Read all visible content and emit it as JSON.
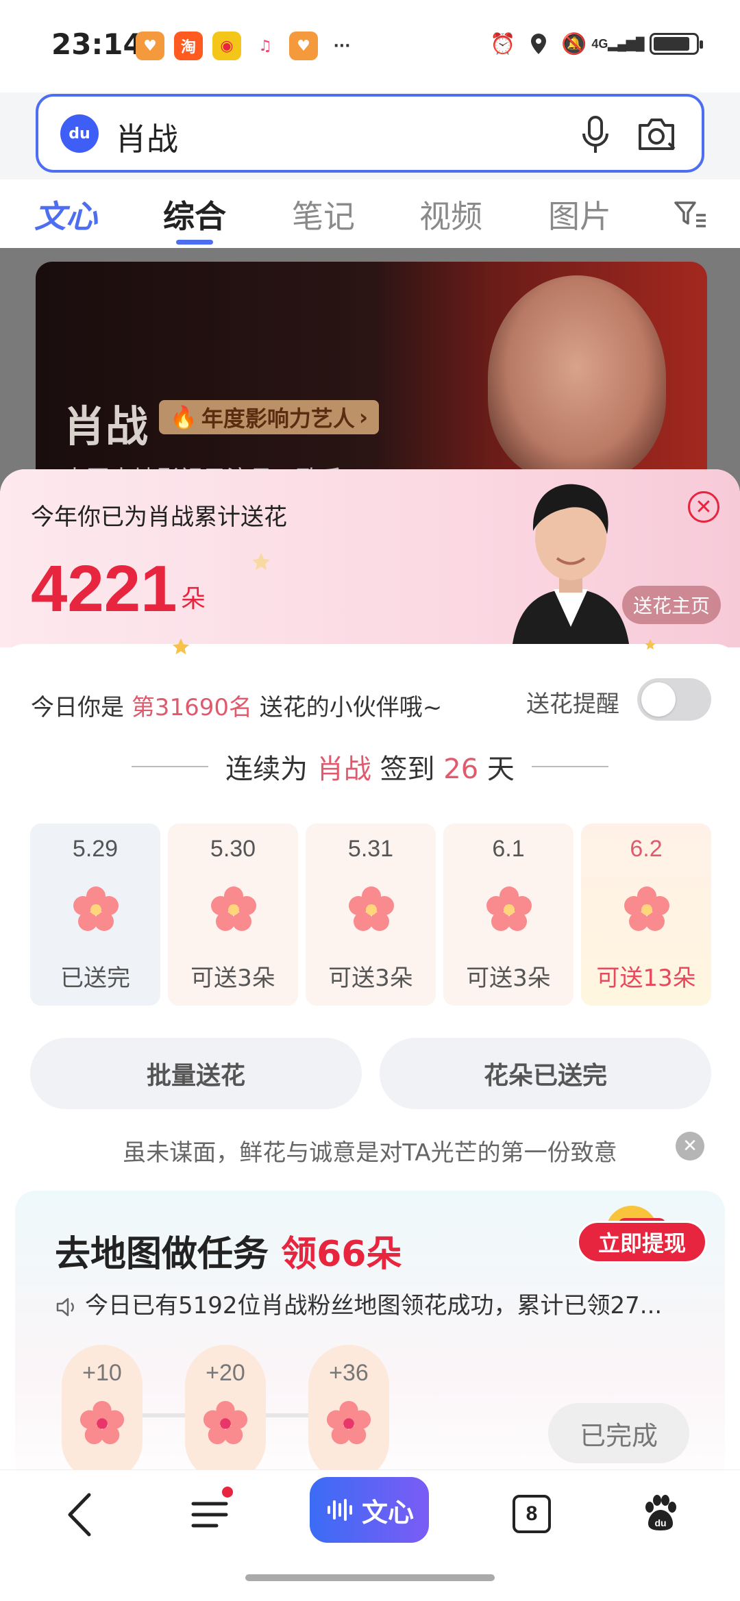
{
  "status_bar": {
    "time": "23:14",
    "app_icons": [
      {
        "name": "heart-app-icon",
        "glyph": "♥",
        "color": "#f59a3c"
      },
      {
        "name": "taobao-app-icon",
        "glyph": "淘",
        "color": "#ff5a1f"
      },
      {
        "name": "weibo-app-icon",
        "glyph": "◉",
        "color": "#f5c61a"
      },
      {
        "name": "music-app-icon",
        "glyph": "♫",
        "color": "#ff3f6b"
      },
      {
        "name": "heart-app-icon-2",
        "glyph": "♥",
        "color": "#f59a3c"
      }
    ],
    "more": "···",
    "network": "4G"
  },
  "search": {
    "query": "肖战"
  },
  "tabs": {
    "wenxin": "文心",
    "items": [
      "综合",
      "笔记",
      "视频",
      "图片"
    ],
    "active": "综合"
  },
  "banner": {
    "title": "肖战",
    "tag": "年度影响力艺人",
    "subtitle": "中国内地影视男演员、歌手"
  },
  "sheet": {
    "heading": "今年你已为肖战累计送花",
    "count": "4221",
    "unit": "朵",
    "home_button": "送花主页",
    "rank_prefix": "今日你是",
    "rank": "第31690名",
    "rank_suffix": "送花的小伙伴哦~",
    "remind_label": "送花提醒",
    "streak_prefix": "连续为",
    "streak_name": "肖战",
    "streak_mid": "签到",
    "streak_days": "26",
    "streak_suffix": "天",
    "days": [
      {
        "date": "5.29",
        "status": "已送完"
      },
      {
        "date": "5.30",
        "status": "可送3朵"
      },
      {
        "date": "5.31",
        "status": "可送3朵"
      },
      {
        "date": "6.1",
        "status": "可送3朵"
      },
      {
        "date": "6.2",
        "status": "可送13朵"
      }
    ],
    "batch_button": "批量送花",
    "sent_out_button": "花朵已送完",
    "quote": "虽未谋面，鲜花与诚意是对TA光芒的第一份致意"
  },
  "task": {
    "title_prefix": "去地图做任务",
    "title_highlight": "领66朵",
    "description": "今日已有5192位肖战粉丝地图领花成功，累计已领27...",
    "withdraw_button": "立即提现",
    "rewards": [
      "+10",
      "+20",
      "+36"
    ],
    "done_button": "已完成"
  },
  "bottom_nav": {
    "wenxin": "文心",
    "tab_count": "8"
  },
  "colors": {
    "accent_blue": "#4e6ef2",
    "brand_red": "#e8253e",
    "highlight_pink": "#e05a6e"
  }
}
